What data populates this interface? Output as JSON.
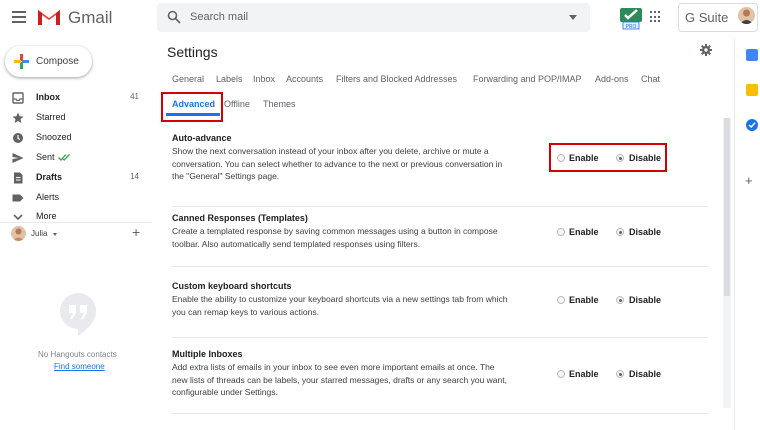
{
  "app": {
    "name": "Gmail",
    "suite": "G Suite"
  },
  "search": {
    "placeholder": "Search mail"
  },
  "compose_label": "Compose",
  "nav": [
    {
      "label": "Inbox",
      "count": "41",
      "bold": true,
      "icon": "inbox-icon"
    },
    {
      "label": "Starred",
      "count": "",
      "bold": false,
      "icon": "star-icon"
    },
    {
      "label": "Snoozed",
      "count": "",
      "bold": false,
      "icon": "clock-icon"
    },
    {
      "label": "Sent",
      "count": "",
      "bold": false,
      "icon": "send-icon"
    },
    {
      "label": "Drafts",
      "count": "14",
      "bold": true,
      "icon": "draft-icon"
    },
    {
      "label": "Alerts",
      "count": "",
      "bold": false,
      "icon": "label-icon"
    },
    {
      "label": "More",
      "count": "",
      "bold": false,
      "icon": "chevron-down-icon"
    }
  ],
  "user": {
    "name": "Julia"
  },
  "hangouts": {
    "empty_text": "No Hangouts contacts",
    "find_link": "Find someone"
  },
  "settings": {
    "title": "Settings",
    "tabs": [
      "General",
      "Labels",
      "Inbox",
      "Accounts",
      "Filters and Blocked Addresses",
      "Forwarding and POP/IMAP",
      "Add-ons",
      "Chat",
      "Advanced",
      "Offline",
      "Themes"
    ],
    "active_tab": "Advanced",
    "enable_label": "Enable",
    "disable_label": "Disable",
    "sections": [
      {
        "title": "Auto-advance",
        "description": "Show the next conversation instead of your inbox after you delete, archive or mute a conversation. You can select whether to advance to the next or previous conversation in the \"General\" Settings page.",
        "value": "Disable"
      },
      {
        "title": "Canned Responses (Templates)",
        "description": "Create a templated response by saving common messages using a button in compose toolbar. Also automatically send templated responses using filters.",
        "value": "Disable"
      },
      {
        "title": "Custom keyboard shortcuts",
        "description": "Enable the ability to customize your keyboard shortcuts via a new settings tab from which you can remap keys to various actions.",
        "value": "Disable"
      },
      {
        "title": "Multiple Inboxes",
        "description": "Add extra lists of emails in your inbox to see even more important emails at once. The new lists of threads can be labels, your starred messages, drafts or any search you want, configurable under Settings.",
        "value": "Disable"
      }
    ]
  },
  "colors": {
    "accent": "#1a73e8",
    "highlight": "#d40000",
    "gmail_red": "#ea4335"
  },
  "addon_badge": "PRO"
}
